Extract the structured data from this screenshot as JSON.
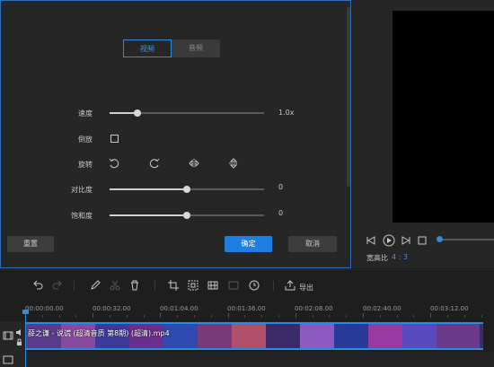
{
  "edit_panel": {
    "tabs": [
      {
        "label": "视频"
      },
      {
        "label": "音频"
      }
    ],
    "speed": {
      "label": "速度",
      "value_text": "1.0x",
      "level": 0.18
    },
    "reverse": {
      "label": "倒放",
      "checked": false
    },
    "rotate": {
      "label": "旋转",
      "icons": [
        "rotate-left-icon",
        "rotate-right-icon",
        "flip-horizontal-icon",
        "flip-vertical-icon"
      ]
    },
    "contrast": {
      "label": "对比度",
      "value_text": "0",
      "level": 0.5
    },
    "saturation": {
      "label": "饱和度",
      "value_text": "0",
      "level": 0.5
    },
    "buttons": {
      "reset": "重置",
      "confirm": "确定",
      "cancel": "取消"
    }
  },
  "preview": {
    "aspect_label": "宽高比",
    "aspect_value": "4 : 3",
    "progress": 0.0
  },
  "toolbar": {
    "export_label": "导出",
    "icons": [
      "undo-icon",
      "redo-icon",
      "pencil-icon",
      "cut-icon",
      "delete-icon",
      "crop-icon",
      "fit-icon",
      "mosaic-icon",
      "freeze-icon",
      "duration-icon",
      "export-icon"
    ]
  },
  "timeline": {
    "ticks": [
      "00:00:00.00",
      "00:00:32.00",
      "00:01:04.00",
      "00:01:36.00",
      "00:02:08.00",
      "00:02:40.00",
      "00:03:12.00"
    ],
    "clip_title": "薛之谦 - 说谎 (超清音质 第8期) (超清).mp4"
  },
  "colors": {
    "accent": "#2f8be0",
    "panel": "#262626",
    "background": "#1e1e1e"
  }
}
